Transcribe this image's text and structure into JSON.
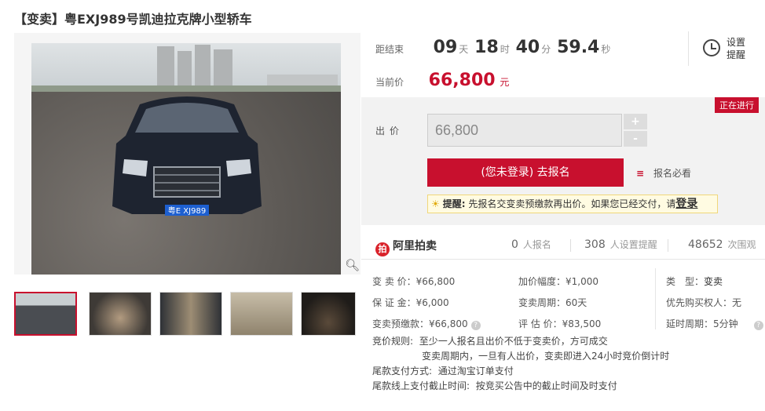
{
  "title": "【变卖】粤EXJ989号凯迪拉克牌小型轿车",
  "gallery": {
    "plate_text": "粤E XJ989",
    "zoom_icon": "magnifier-icon",
    "thumbnails": [
      "front-exterior",
      "dashboard-interior",
      "front-seat-interior",
      "rear-seat-interior",
      "trunk-interior"
    ]
  },
  "countdown": {
    "label": "距结束",
    "days": "09",
    "days_unit": "天",
    "hours": "18",
    "hours_unit": "时",
    "minutes": "40",
    "minutes_unit": "分",
    "seconds": "59.4",
    "seconds_unit": "秒"
  },
  "remind": {
    "label": "设置提醒",
    "icon": "alarm-clock-icon"
  },
  "current_price": {
    "label": "当前价",
    "value": "66,800",
    "unit": "元"
  },
  "status_badge": "正在进行",
  "bid": {
    "label": "出价",
    "value": "66,800",
    "plus": "+",
    "minus": "-",
    "signup_button": "(您未登录) 去报名",
    "must_see": "报名必看",
    "tip_label": "提醒:",
    "tip_text": "先报名交变卖预缴款再出价。如果您已经交付，请",
    "tip_login": "登录"
  },
  "stats": {
    "brand": "阿里拍卖",
    "signups": "0",
    "signups_label": "人报名",
    "reminders": "308",
    "reminders_label": "人设置提醒",
    "views": "48652",
    "views_label": "次围观"
  },
  "info": {
    "col1": [
      {
        "key": "变 卖 价：",
        "value": "¥66,800"
      },
      {
        "key": "保 证 金：",
        "value": "¥6,000"
      },
      {
        "key": "变卖预缴款：",
        "value": "¥66,800"
      }
    ],
    "col2": [
      {
        "key": "加价幅度：",
        "value": "¥1,000"
      },
      {
        "key": "变卖周期：",
        "value": "60天"
      },
      {
        "key": "评 估 价：",
        "value": "¥83,500"
      }
    ],
    "col3": [
      {
        "key": "类　型：",
        "value": "变卖"
      },
      {
        "key": "优先购买权人",
        "value": "：无"
      },
      {
        "key": "延时周期：",
        "value": "5分钟"
      }
    ]
  },
  "rules": {
    "rule_label": "竞价规则:",
    "rule_line1": "至少一人报名且出价不低于变卖价，方可成交",
    "rule_line2": "变卖周期内，一旦有人出价，变卖即进入24小时竞价倒计时",
    "payment_label": "尾款支付方式:",
    "payment_value": "通过淘宝订单支付",
    "deadline_label": "尾款线上支付截止时间:",
    "deadline_value": "按竞买公告中的截止时间及时支付"
  }
}
